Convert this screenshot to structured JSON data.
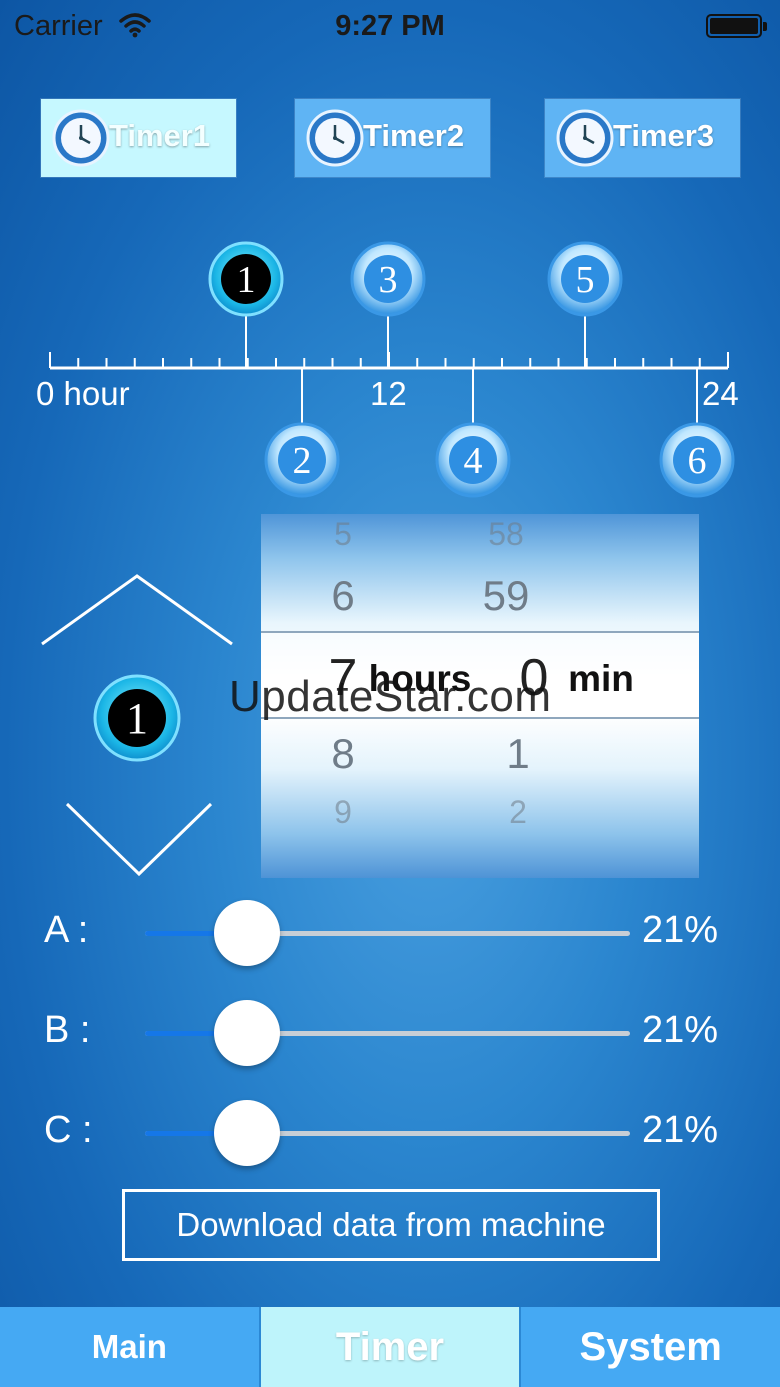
{
  "status_bar": {
    "carrier": "Carrier",
    "time": "9:27 PM"
  },
  "timer_tabs": [
    {
      "label": "Timer1",
      "active": true
    },
    {
      "label": "Timer2",
      "active": false
    },
    {
      "label": "Timer3",
      "active": false
    }
  ],
  "timeline": {
    "start_label": "0 hour",
    "mid_label": "12",
    "end_label": "24",
    "markers_top": [
      "1",
      "3",
      "5"
    ],
    "markers_bottom": [
      "2",
      "4",
      "6"
    ]
  },
  "selected_marker": "1",
  "picker": {
    "hours": [
      "5",
      "6",
      "7",
      "8",
      "9"
    ],
    "minutes": [
      "58",
      "59",
      "0",
      "1",
      "2"
    ],
    "hours_unit": "hours",
    "minutes_unit": "min"
  },
  "watermark": "UpdateStar.com",
  "sliders": [
    {
      "label": "A :",
      "value_text": "21%",
      "value": 0.21
    },
    {
      "label": "B :",
      "value_text": "21%",
      "value": 0.21
    },
    {
      "label": "C :",
      "value_text": "21%",
      "value": 0.21
    }
  ],
  "download_button": "Download data from machine",
  "bottom_tabs": [
    {
      "label": "Main"
    },
    {
      "label": "Timer"
    },
    {
      "label": "System"
    }
  ],
  "colors": {
    "accent": "#1577e8",
    "tab_active": "#bef4fb",
    "tab": "#45a9f3"
  }
}
